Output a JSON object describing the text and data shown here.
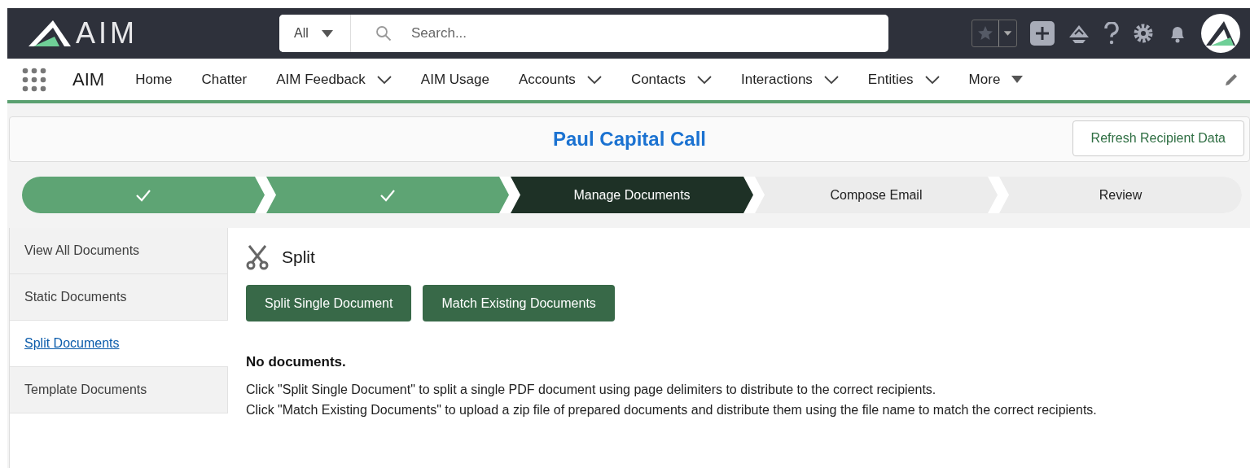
{
  "header": {
    "logo_text": "AIM",
    "search": {
      "scope": "All",
      "placeholder": "Search..."
    }
  },
  "nav": {
    "app_name": "AIM",
    "items": [
      {
        "label": "Home",
        "kind": "plain"
      },
      {
        "label": "Chatter",
        "kind": "plain"
      },
      {
        "label": "AIM Feedback",
        "kind": "chevron"
      },
      {
        "label": "AIM Usage",
        "kind": "plain"
      },
      {
        "label": "Accounts",
        "kind": "chevron"
      },
      {
        "label": "Contacts",
        "kind": "chevron"
      },
      {
        "label": "Interactions",
        "kind": "chevron"
      },
      {
        "label": "Entities",
        "kind": "chevron"
      },
      {
        "label": "More",
        "kind": "triangle"
      }
    ]
  },
  "page_header": {
    "title": "Paul Capital Call",
    "button": "Refresh Recipient Data"
  },
  "path": [
    {
      "kind": "complete"
    },
    {
      "kind": "complete"
    },
    {
      "label": "Manage Documents",
      "kind": "current"
    },
    {
      "label": "Compose Email",
      "kind": "incomplete"
    },
    {
      "label": "Review",
      "kind": "incomplete"
    }
  ],
  "sidebar": [
    {
      "label": "View All Documents",
      "selected": false
    },
    {
      "label": "Static Documents",
      "selected": false
    },
    {
      "label": "Split Documents",
      "selected": true
    },
    {
      "label": "Template Documents",
      "selected": false
    }
  ],
  "main": {
    "title": "Split",
    "buttons": [
      "Split Single Document",
      "Match Existing Documents"
    ],
    "empty_title": "No documents.",
    "paragraphs": [
      "Click \"Split Single Document\" to split a single PDF document using page delimiters to distribute to the correct recipients.",
      "Click \"Match Existing Documents\" to upload a zip file of prepared documents and distribute them using the file name to match the correct recipients."
    ]
  }
}
